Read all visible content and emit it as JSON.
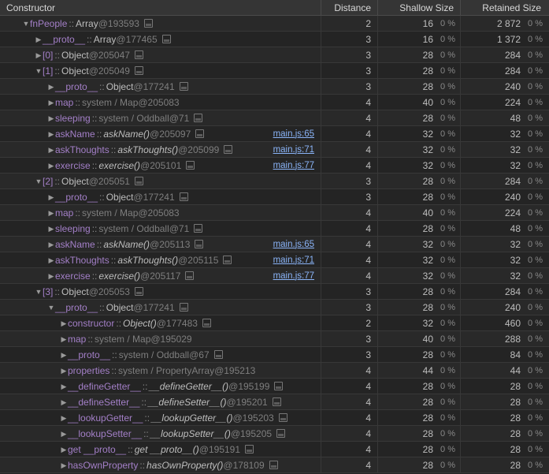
{
  "chart_data": {
    "type": "table"
  },
  "header": {
    "constructor": "Constructor",
    "distance": "Distance",
    "shallow": "Shallow Size",
    "retained": "Retained Size"
  },
  "rows": [
    {
      "indent": 0,
      "arrow": "down",
      "prop": "fnPeople",
      "sep": " :: ",
      "typeKind": "type",
      "type": "Array",
      "addr": "@193593",
      "icon": true,
      "src": "",
      "dist": "2",
      "sh": "16",
      "shp": "0 %",
      "re": "2 872",
      "rep": "0 %"
    },
    {
      "indent": 1,
      "arrow": "right",
      "prop": "__proto__",
      "sep": " :: ",
      "typeKind": "type",
      "type": "Array",
      "addr": "@177465",
      "icon": true,
      "src": "",
      "dist": "3",
      "sh": "16",
      "shp": "0 %",
      "re": "1 372",
      "rep": "0 %"
    },
    {
      "indent": 1,
      "arrow": "right",
      "prop": "[0]",
      "sep": " :: ",
      "typeKind": "type",
      "type": "Object",
      "addr": "@205047",
      "icon": true,
      "src": "",
      "dist": "3",
      "sh": "28",
      "shp": "0 %",
      "re": "284",
      "rep": "0 %"
    },
    {
      "indent": 1,
      "arrow": "down",
      "prop": "[1]",
      "sep": " :: ",
      "typeKind": "type",
      "type": "Object",
      "addr": "@205049",
      "icon": true,
      "src": "",
      "dist": "3",
      "sh": "28",
      "shp": "0 %",
      "re": "284",
      "rep": "0 %"
    },
    {
      "indent": 2,
      "arrow": "right",
      "prop": "__proto__",
      "sep": " :: ",
      "typeKind": "type",
      "type": "Object",
      "addr": "@177241",
      "icon": true,
      "src": "",
      "dist": "3",
      "sh": "28",
      "shp": "0 %",
      "re": "240",
      "rep": "0 %"
    },
    {
      "indent": 2,
      "arrow": "right",
      "prop": "map",
      "sep": " :: ",
      "typeKind": "sys",
      "type": "system / Map",
      "addr": "@205083",
      "icon": false,
      "src": "",
      "dist": "4",
      "sh": "40",
      "shp": "0 %",
      "re": "224",
      "rep": "0 %"
    },
    {
      "indent": 2,
      "arrow": "right",
      "prop": "sleeping",
      "sep": " :: ",
      "typeKind": "sys",
      "type": "system / Oddball",
      "addr": "@71",
      "icon": true,
      "src": "",
      "dist": "4",
      "sh": "28",
      "shp": "0 %",
      "re": "48",
      "rep": "0 %"
    },
    {
      "indent": 2,
      "arrow": "right",
      "prop": "askName",
      "sep": " :: ",
      "typeKind": "fn",
      "type": "askName()",
      "addr": "@205097",
      "icon": true,
      "src": "main.js:65",
      "dist": "4",
      "sh": "32",
      "shp": "0 %",
      "re": "32",
      "rep": "0 %"
    },
    {
      "indent": 2,
      "arrow": "right",
      "prop": "askThoughts",
      "sep": " :: ",
      "typeKind": "fn",
      "type": "askThoughts()",
      "addr": "@205099",
      "icon": true,
      "src": "main.js:71",
      "dist": "4",
      "sh": "32",
      "shp": "0 %",
      "re": "32",
      "rep": "0 %"
    },
    {
      "indent": 2,
      "arrow": "right",
      "prop": "exercise",
      "sep": " :: ",
      "typeKind": "fn",
      "type": "exercise()",
      "addr": "@205101",
      "icon": true,
      "src": "main.js:77",
      "dist": "4",
      "sh": "32",
      "shp": "0 %",
      "re": "32",
      "rep": "0 %"
    },
    {
      "indent": 1,
      "arrow": "down",
      "prop": "[2]",
      "sep": " :: ",
      "typeKind": "type",
      "type": "Object",
      "addr": "@205051",
      "icon": true,
      "src": "",
      "dist": "3",
      "sh": "28",
      "shp": "0 %",
      "re": "284",
      "rep": "0 %"
    },
    {
      "indent": 2,
      "arrow": "right",
      "prop": "__proto__",
      "sep": " :: ",
      "typeKind": "type",
      "type": "Object",
      "addr": "@177241",
      "icon": true,
      "src": "",
      "dist": "3",
      "sh": "28",
      "shp": "0 %",
      "re": "240",
      "rep": "0 %"
    },
    {
      "indent": 2,
      "arrow": "right",
      "prop": "map",
      "sep": " :: ",
      "typeKind": "sys",
      "type": "system / Map",
      "addr": "@205083",
      "icon": false,
      "src": "",
      "dist": "4",
      "sh": "40",
      "shp": "0 %",
      "re": "224",
      "rep": "0 %"
    },
    {
      "indent": 2,
      "arrow": "right",
      "prop": "sleeping",
      "sep": " :: ",
      "typeKind": "sys",
      "type": "system / Oddball",
      "addr": "@71",
      "icon": true,
      "src": "",
      "dist": "4",
      "sh": "28",
      "shp": "0 %",
      "re": "48",
      "rep": "0 %"
    },
    {
      "indent": 2,
      "arrow": "right",
      "prop": "askName",
      "sep": " :: ",
      "typeKind": "fn",
      "type": "askName()",
      "addr": "@205113",
      "icon": true,
      "src": "main.js:65",
      "dist": "4",
      "sh": "32",
      "shp": "0 %",
      "re": "32",
      "rep": "0 %"
    },
    {
      "indent": 2,
      "arrow": "right",
      "prop": "askThoughts",
      "sep": " :: ",
      "typeKind": "fn",
      "type": "askThoughts()",
      "addr": "@205115",
      "icon": true,
      "src": "main.js:71",
      "dist": "4",
      "sh": "32",
      "shp": "0 %",
      "re": "32",
      "rep": "0 %"
    },
    {
      "indent": 2,
      "arrow": "right",
      "prop": "exercise",
      "sep": " :: ",
      "typeKind": "fn",
      "type": "exercise()",
      "addr": "@205117",
      "icon": true,
      "src": "main.js:77",
      "dist": "4",
      "sh": "32",
      "shp": "0 %",
      "re": "32",
      "rep": "0 %"
    },
    {
      "indent": 1,
      "arrow": "down",
      "prop": "[3]",
      "sep": " :: ",
      "typeKind": "type",
      "type": "Object",
      "addr": "@205053",
      "icon": true,
      "src": "",
      "dist": "3",
      "sh": "28",
      "shp": "0 %",
      "re": "284",
      "rep": "0 %"
    },
    {
      "indent": 2,
      "arrow": "down",
      "prop": "__proto__",
      "sep": " :: ",
      "typeKind": "type",
      "type": "Object",
      "addr": "@177241",
      "icon": true,
      "src": "",
      "dist": "3",
      "sh": "28",
      "shp": "0 %",
      "re": "240",
      "rep": "0 %"
    },
    {
      "indent": 3,
      "arrow": "right",
      "prop": "constructor",
      "sep": " :: ",
      "typeKind": "fn",
      "type": "Object()",
      "addr": "@177483",
      "icon": true,
      "src": "",
      "dist": "2",
      "sh": "32",
      "shp": "0 %",
      "re": "460",
      "rep": "0 %"
    },
    {
      "indent": 3,
      "arrow": "right",
      "prop": "map",
      "sep": " :: ",
      "typeKind": "sys",
      "type": "system / Map",
      "addr": "@195029",
      "icon": false,
      "src": "",
      "dist": "3",
      "sh": "40",
      "shp": "0 %",
      "re": "288",
      "rep": "0 %"
    },
    {
      "indent": 3,
      "arrow": "right",
      "prop": "__proto__",
      "sep": " :: ",
      "typeKind": "sys",
      "type": "system / Oddball",
      "addr": "@67",
      "icon": true,
      "src": "",
      "dist": "3",
      "sh": "28",
      "shp": "0 %",
      "re": "84",
      "rep": "0 %"
    },
    {
      "indent": 3,
      "arrow": "right",
      "prop": "properties",
      "sep": " :: ",
      "typeKind": "sys",
      "type": "system / PropertyArray",
      "addr": "@195213",
      "icon": false,
      "src": "",
      "dist": "4",
      "sh": "44",
      "shp": "0 %",
      "re": "44",
      "rep": "0 %"
    },
    {
      "indent": 3,
      "arrow": "right",
      "prop": "__defineGetter__",
      "sep": " :: ",
      "typeKind": "fn",
      "type": "__defineGetter__()",
      "addr": "@195199",
      "icon": true,
      "src": "",
      "dist": "4",
      "sh": "28",
      "shp": "0 %",
      "re": "28",
      "rep": "0 %"
    },
    {
      "indent": 3,
      "arrow": "right",
      "prop": "__defineSetter__",
      "sep": " :: ",
      "typeKind": "fn",
      "type": "__defineSetter__()",
      "addr": "@195201",
      "icon": true,
      "src": "",
      "dist": "4",
      "sh": "28",
      "shp": "0 %",
      "re": "28",
      "rep": "0 %"
    },
    {
      "indent": 3,
      "arrow": "right",
      "prop": "__lookupGetter__",
      "sep": " :: ",
      "typeKind": "fn",
      "type": "__lookupGetter__()",
      "addr": "@195203",
      "icon": true,
      "src": "",
      "dist": "4",
      "sh": "28",
      "shp": "0 %",
      "re": "28",
      "rep": "0 %"
    },
    {
      "indent": 3,
      "arrow": "right",
      "prop": "__lookupSetter__",
      "sep": " :: ",
      "typeKind": "fn",
      "type": "__lookupSetter__()",
      "addr": "@195205",
      "icon": true,
      "src": "",
      "dist": "4",
      "sh": "28",
      "shp": "0 %",
      "re": "28",
      "rep": "0 %"
    },
    {
      "indent": 3,
      "arrow": "right",
      "prop": "get __proto__",
      "sep": " :: ",
      "typeKind": "fn",
      "type": "get __proto__()",
      "addr": "@195191",
      "icon": true,
      "src": "",
      "dist": "4",
      "sh": "28",
      "shp": "0 %",
      "re": "28",
      "rep": "0 %"
    },
    {
      "indent": 3,
      "arrow": "right",
      "prop": "hasOwnProperty",
      "sep": " :: ",
      "typeKind": "fn",
      "type": "hasOwnProperty()",
      "addr": "@178109",
      "icon": true,
      "src": "",
      "dist": "4",
      "sh": "28",
      "shp": "0 %",
      "re": "28",
      "rep": "0 %"
    }
  ]
}
